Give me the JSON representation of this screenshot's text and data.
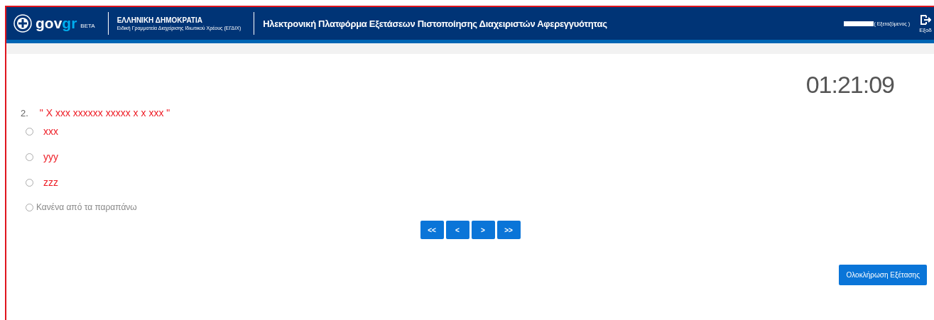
{
  "header": {
    "logo_text": "gov",
    "logo_accent": "gr",
    "logo_badge": "BETA",
    "org_title": "ΕΛΛΗΝΙΚΗ ΔΗΜΟΚΡΑΤΙΑ",
    "org_subtitle": "Ειδική Γραμματεία Διαχείρισης Ιδιωτικού Χρέους (ΕΓΔΙΧ)",
    "platform_title": "Ηλεκτρονική Πλατφόρμα Εξετάσεων Πιστοποίησης Διαχειριστών Αφερεγγυότητας",
    "user_role": "( Εξεταζόμενος )",
    "logout_label": "Εξοδ"
  },
  "timer": "01:21:09",
  "question": {
    "number": "2.",
    "text": "\" Χ xxx xxxxxx xxxxx x x xxx \"",
    "options": [
      {
        "label": "xxx",
        "kind": "marked",
        "selected": false
      },
      {
        "label": "yyy",
        "kind": "marked",
        "selected": false
      },
      {
        "label": "zzz",
        "kind": "marked",
        "selected": false
      },
      {
        "label": "Κανένα από τα παραπάνω",
        "kind": "plain",
        "selected": false
      }
    ]
  },
  "pager": [
    "<<",
    "<",
    ">",
    ">>"
  ],
  "finish_button": "Ολοκλήρωση Εξέτασης"
}
